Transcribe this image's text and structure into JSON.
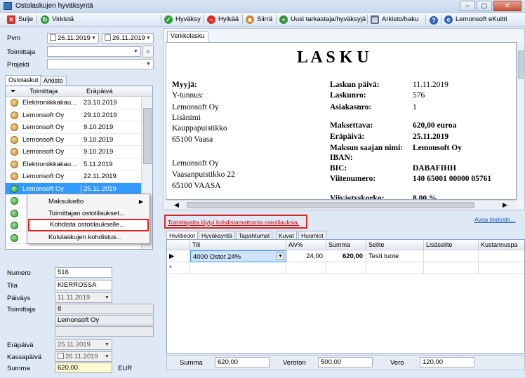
{
  "window": {
    "title": "Ostolaskujen hyväksyntä",
    "minimize": "–",
    "maximize": "▢",
    "close": "✕"
  },
  "left_toolbar": {
    "close_label": "Sulje",
    "refresh_label": "Virkistä"
  },
  "right_toolbar": {
    "approve_label": "Hyväksy",
    "reject_label": "Hylkää",
    "transfer_label": "Siirrä",
    "new_checker_label": "Uusi tarkastaja/hyväksyjä",
    "archive_label": "Arkisto/haku",
    "help_label": "?",
    "ekuitti_label": "Lemonsoft eKuitti"
  },
  "filters": {
    "pvm_label": "Pvm",
    "pvm_from": "26.11.2019",
    "pvm_to": "26.11.2019",
    "supplier_label": "Toimittaja",
    "supplier_value": "",
    "project_label": "Projekti",
    "project_value": ""
  },
  "left_tabs": [
    "Ostolaskut",
    "Arkisto"
  ],
  "invoice_list": {
    "col_supplier": "Toimittaja",
    "col_due": "Eräpäivä",
    "rows": [
      {
        "status": "orange",
        "supplier": "Elektroniikkakau...",
        "due": "23.10.2019"
      },
      {
        "status": "orange",
        "supplier": "Lemonsoft Oy",
        "due": "29.10.2019"
      },
      {
        "status": "orange",
        "supplier": "Lemonsoft Oy",
        "due": "9.10.2019"
      },
      {
        "status": "orange",
        "supplier": "Lemonsoft Oy",
        "due": "9.10.2019"
      },
      {
        "status": "orange",
        "supplier": "Lemonsoft Oy",
        "due": "9.10.2019"
      },
      {
        "status": "orange",
        "supplier": "Elektroniikkakau...",
        "due": "5.11.2019"
      },
      {
        "status": "orange",
        "supplier": "Lemonsoft Oy",
        "due": "22.11.2019"
      },
      {
        "status": "green",
        "supplier": "Lemonsoft Oy",
        "due": "25.11.2019"
      },
      {
        "status": "green",
        "supplier": "",
        "due": ""
      },
      {
        "status": "green",
        "supplier": "",
        "due": ""
      },
      {
        "status": "green",
        "supplier": "",
        "due": ""
      },
      {
        "status": "green",
        "supplier": "",
        "due": ""
      }
    ]
  },
  "context_menu": {
    "items": [
      "Maksukielto",
      "Toimittajan ostotilaukset...",
      "Kohdista ostotilaukselle...",
      "Kululaskujen kohdistus..."
    ],
    "submenu_arrow": "▶"
  },
  "details": {
    "numero_label": "Numero",
    "numero": "516",
    "tila_label": "Tila",
    "tila": "KIERROSSA",
    "paivays_label": "Päiväys",
    "paivays": "11.11.2019",
    "toimittaja_label": "Toimittaja",
    "toimittaja_id": "8",
    "toimittaja_name": "Lemonsoft Oy",
    "erapaiva_label": "Eräpäivä",
    "erapaiva": "25.11.2019",
    "kassapaiva_label": "Kassapäivä",
    "kassapaiva": "26.11.2019",
    "summa_label": "Summa",
    "summa": "620,00",
    "currency": "EUR"
  },
  "document_tab": "Verkkolasku",
  "invoice_doc": {
    "title": "L A S K U",
    "seller_label": "Myyjä:",
    "ytunnus_label": "Y-tunnus:",
    "seller_lines": [
      "Lemonsoft Oy",
      "Lisänimi",
      "Kauppapuistikko",
      "65100 Vaasa"
    ],
    "buyer_lines": [
      "Lemonsoft Oy",
      "Vaasanpuistikko 22",
      "65100 VAASA"
    ],
    "fields": [
      {
        "label": "Laskun päivä:",
        "value": "11.11.2019",
        "bold": false
      },
      {
        "label": "Laskunro:",
        "value": "576",
        "bold": false
      },
      {
        "label": "Asiakasnro:",
        "value": "1",
        "bold": false
      },
      {
        "label": "Maksettava:",
        "value": "620,00 euroa",
        "bold": true
      },
      {
        "label": "Eräpäivä:",
        "value": "25.11.2019",
        "bold": true
      },
      {
        "label": "Maksun saajan nimi:",
        "value": "Lemonsoft Oy",
        "bold": true
      },
      {
        "label": "IBAN:",
        "value": "",
        "bold": true
      },
      {
        "label": "BIC:",
        "value": "DABAFIHH",
        "bold": true
      },
      {
        "label": "Viitenumero:",
        "value": "140 65001 00000 05761",
        "bold": true
      },
      {
        "label": "Viivästyskorko:",
        "value": "8,00 %",
        "bold": true
      }
    ]
  },
  "warning_link": "Toimittajalta löytyi kohdistamattomia ostotilauksia.",
  "open_file_link": "Avaa tiedosto...",
  "detail_tabs": [
    "Hiviitiedot",
    "Hyväksyntä",
    "Tapahtumat",
    "Kuvat",
    "Huomiot"
  ],
  "accounting_grid": {
    "headers": [
      "Tili",
      "Alv%",
      "Summa",
      "Selite",
      "Lisäselite",
      "Kustannuspa"
    ],
    "rows": [
      {
        "marker": "▶",
        "tili": "4000 Ostot 24%",
        "alv": "24,00",
        "summa": "620,00",
        "selite": "Testi tuote",
        "lisaselite": "",
        "kustannus": ""
      },
      {
        "marker": "*",
        "tili": "",
        "alv": "",
        "summa": "",
        "selite": "",
        "lisaselite": "",
        "kustannus": ""
      }
    ]
  },
  "totals": {
    "summa_label": "Summa",
    "summa": "620,00",
    "veroton_label": "Veroton",
    "veroton": "500,00",
    "vero_label": "Vero",
    "vero": "120,00"
  },
  "colors": {
    "accent": "#3399ff",
    "warning": "#cc0000",
    "highlight_border": "#dd2222"
  }
}
